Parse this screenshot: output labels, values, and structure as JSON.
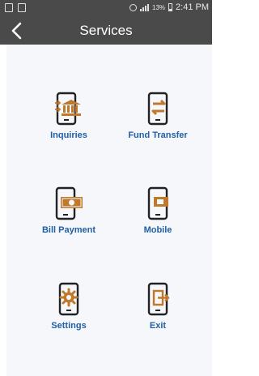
{
  "status_bar": {
    "battery_percent": "13%",
    "time": "2:41 PM"
  },
  "header": {
    "title": "Services",
    "back_icon": "chevron-left-icon"
  },
  "services": [
    {
      "label": "Inquiries",
      "icon": "bank-phone-icon"
    },
    {
      "label": "Fund Transfer",
      "icon": "transfer-phone-icon"
    },
    {
      "label": "Bill Payment",
      "icon": "cash-phone-icon"
    },
    {
      "label": "Mobile",
      "icon": "card-phone-icon"
    },
    {
      "label": "Settings",
      "icon": "gear-phone-icon"
    },
    {
      "label": "Exit",
      "icon": "exit-phone-icon"
    }
  ],
  "colors": {
    "bar": "#4a4a4a",
    "accent": "#c0782a",
    "label": "#1f5fa6",
    "outline": "#222222",
    "background": "#f6f7fb"
  }
}
